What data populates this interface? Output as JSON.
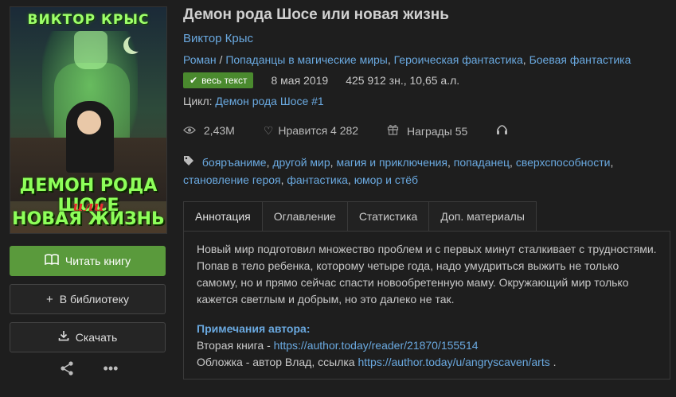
{
  "book": {
    "cover": {
      "author_text": "ВИКТОР КРЫС",
      "title_line1": "ДЕМОН РОДА ШОСЕ",
      "title_line2": "или",
      "title_line3": "НОВАЯ ЖИЗНЬ"
    },
    "title": "Демон рода Шосе или новая жизнь",
    "author": "Виктор Крыс",
    "genres": {
      "primary": "Роман",
      "separator": " / ",
      "items": [
        "Попаданцы в магические миры",
        "Героическая фантастика",
        "Боевая фантастика"
      ]
    },
    "status_badge": "весь текст",
    "date": "8 мая 2019",
    "size": "425 912 зн., 10,65 а.л.",
    "cycle_label": "Цикл:",
    "cycle_link": "Демон рода Шосе #1",
    "stats": {
      "views": "2,43M",
      "likes_label": "Нравится",
      "likes": "4 282",
      "awards_label": "Награды",
      "awards": "55"
    },
    "tags": [
      "бояръаниме",
      "другой мир",
      "магия и приключения",
      "попаданец",
      "сверхспособности",
      "становление героя",
      "фантастика",
      "юмор и стёб"
    ]
  },
  "actions": {
    "read": "Читать книгу",
    "library": "В библиотеку",
    "download": "Скачать"
  },
  "tabs": [
    "Аннотация",
    "Оглавление",
    "Статистика",
    "Доп. материалы"
  ],
  "annotation": {
    "text": "Новый мир подготовил множество проблем и с первых минут сталкивает с трудностями. Попав в тело ребенка, которому четыре года, надо умудриться выжить не только самому, но и прямо сейчас спасти новообретенную маму. Окружающий мир только кажется светлым и добрым, но это далеко не так.",
    "note_title": "Примечания автора:",
    "line1_prefix": "Вторая книга - ",
    "line1_link": "https://author.today/reader/21870/155514",
    "line2_prefix": "Обложка - автор Влад, ссылка ",
    "line2_link": "https://author.today/u/angryscaven/arts",
    "line2_suffix": " ."
  }
}
